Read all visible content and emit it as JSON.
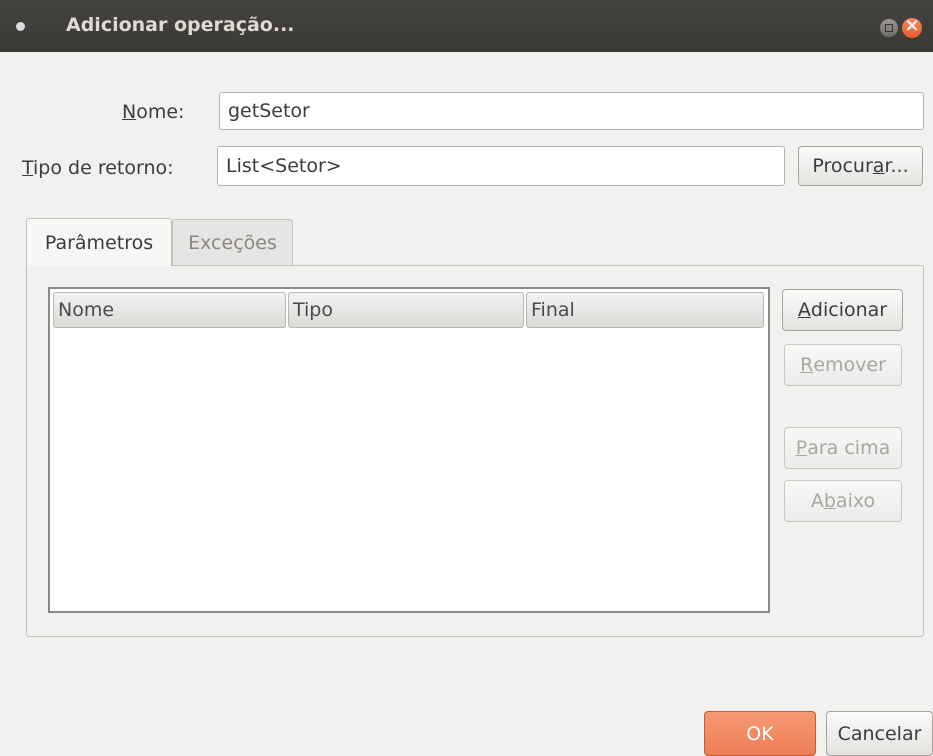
{
  "window": {
    "title": "Adicionar operação..."
  },
  "form": {
    "name_label": "Nome:",
    "name_value": "getSetor",
    "return_type_label": "Tipo de retorno:",
    "return_type_value": "List<Setor>",
    "browse_button": "Procurar..."
  },
  "tabs": [
    {
      "label": "Parâmetros",
      "active": true
    },
    {
      "label": "Exceções",
      "active": false
    }
  ],
  "table": {
    "columns": [
      "Nome",
      "Tipo",
      "Final"
    ],
    "rows": []
  },
  "side_buttons": {
    "add": "Adicionar",
    "remove": "Remover",
    "up": "Para cima",
    "down": "Abaixo"
  },
  "footer": {
    "ok": "OK",
    "cancel": "Cancelar"
  }
}
